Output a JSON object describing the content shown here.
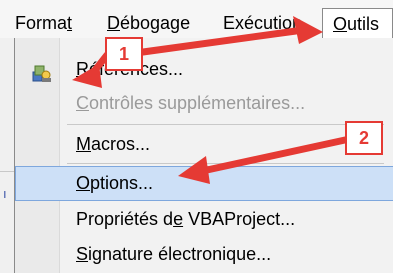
{
  "menubar": {
    "format": {
      "pre": "Forma",
      "key": "t",
      "post": ""
    },
    "debogage": {
      "pre": "",
      "key": "D",
      "post": "ébogage"
    },
    "execution": {
      "pre": "Exécution",
      "key": "",
      "post": ""
    },
    "outils": {
      "pre": "",
      "key": "O",
      "post": "utils"
    }
  },
  "dropdown": {
    "references": {
      "pre": "",
      "key": "R",
      "post": "éférences..."
    },
    "controles": {
      "pre": "",
      "key": "C",
      "post": "ontrôles supplémentaires..."
    },
    "macros": {
      "pre": "",
      "key": "M",
      "post": "acros..."
    },
    "options": {
      "pre": "",
      "key": "O",
      "post": "ptions..."
    },
    "proprietes": {
      "pre": "Propriétés d",
      "key": "e",
      "post": " VBAProject..."
    },
    "signature": {
      "pre": "",
      "key": "S",
      "post": "ignature électronique..."
    }
  },
  "annotations": {
    "step1": "1",
    "step2": "2"
  },
  "background_fragment": "ı",
  "colors": {
    "annotation": "#e53a34",
    "highlight": "#cde0f7",
    "highlight_border": "#7ea7dd"
  },
  "icons": {
    "references": "references-icon"
  }
}
